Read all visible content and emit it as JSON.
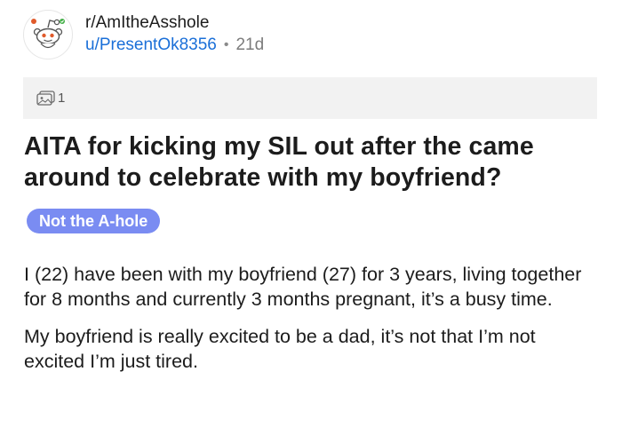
{
  "post": {
    "subreddit": "r/AmItheAsshole",
    "username": "u/PresentOk8356",
    "separator": "•",
    "age": "21d",
    "media_count": "1",
    "title": "AITA for kicking my SIL out after the came around to celebrate with my boyfriend?",
    "flair": "Not the A-hole",
    "body": [
      "I (22) have been with my boyfriend (27) for 3 years, living together for 8 months and currently 3 months pregnant, it’s a busy time.",
      "My boyfriend is really excited to be a dad, it’s not that I’m not excited I’m just tired."
    ]
  },
  "colors": {
    "username": "#1a6fd8",
    "flair_background": "#7a8cf2",
    "media_bar": "#f2f2f2",
    "text": "#1c1c1c"
  },
  "icons": {
    "avatar": "snoo-avatar-icon",
    "media": "media-gallery-icon"
  }
}
